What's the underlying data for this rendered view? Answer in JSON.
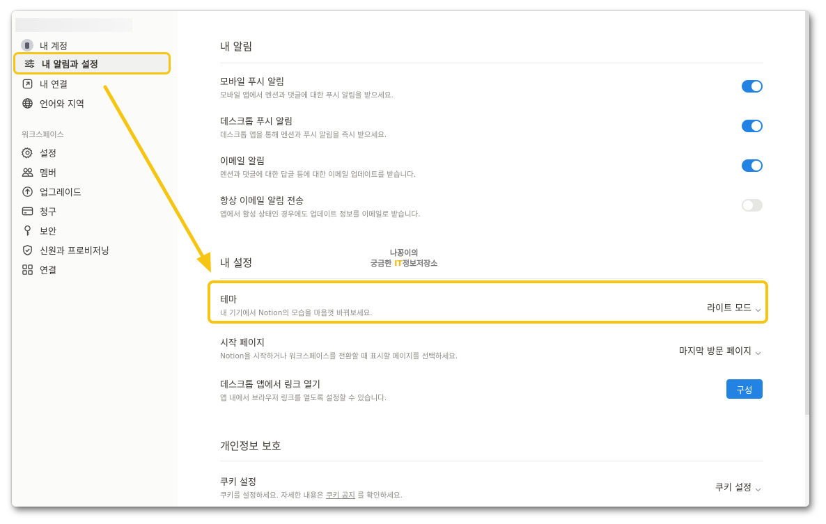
{
  "sidebar": {
    "account_items": [
      {
        "label": "내 계정",
        "icon": "avatar-icon"
      },
      {
        "label": "내 알림과 설정",
        "icon": "sliders-icon",
        "selected": true
      },
      {
        "label": "내 연결",
        "icon": "external-link-icon"
      },
      {
        "label": "언어와 지역",
        "icon": "globe-icon"
      }
    ],
    "workspace_title": "워크스페이스",
    "workspace_items": [
      {
        "label": "설정",
        "icon": "gear-icon"
      },
      {
        "label": "멤버",
        "icon": "members-icon"
      },
      {
        "label": "업그레이드",
        "icon": "upgrade-icon"
      },
      {
        "label": "청구",
        "icon": "card-icon"
      },
      {
        "label": "보안",
        "icon": "key-icon"
      },
      {
        "label": "신원과 프로비저닝",
        "icon": "shield-icon"
      },
      {
        "label": "연결",
        "icon": "grid-icon"
      }
    ]
  },
  "notifications": {
    "title": "내 알림",
    "items": [
      {
        "title": "모바일 푸시 알림",
        "desc": "모바일 앱에서 멘션과 댓글에 대한 푸시 알림을 받으세요.",
        "on": true
      },
      {
        "title": "데스크톱 푸시 알림",
        "desc": "데스크톱 앱을 통해 멘션과 푸시 알림을 즉시 받으세요.",
        "on": true
      },
      {
        "title": "이메일 알림",
        "desc": "멘션과 댓글에 대한 답글 등에 대한 이메일 업데이트를 받습니다.",
        "on": true
      },
      {
        "title": "항상 이메일 알림 전송",
        "desc": "앱에서 활성 상태인 경우에도 업데이트 정보를 이메일로 받습니다.",
        "on": false
      }
    ]
  },
  "settings": {
    "title": "내 설정",
    "theme": {
      "title": "테마",
      "desc": "내 기기에서 Notion의 모습을 마음껏 바꿔보세요.",
      "value": "라이트 모드"
    },
    "start_page": {
      "title": "시작 페이지",
      "desc": "Notion을 시작하거나 워크스페이스를 전환할 때 표시할 페이지를 선택하세요.",
      "value": "마지막 방문 페이지"
    },
    "desktop_links": {
      "title": "데스크톱 앱에서 링크 열기",
      "desc": "앱 내에서 브라우저 링크를 열도록 설정할 수 있습니다.",
      "button": "구성"
    }
  },
  "privacy": {
    "title": "개인정보 보호",
    "cookies": {
      "title": "쿠키 설정",
      "desc_pre": "쿠키를 설정하세요. 자세한 내용은 ",
      "desc_link": "쿠키 공지",
      "desc_post": " 를 확인하세요.",
      "value": "쿠키 설정"
    }
  },
  "watermark": {
    "line1": "나꽁이의",
    "line2_pre": "궁금한 ",
    "line2_it": "IT",
    "line2_post": "정보저장소"
  },
  "colors": {
    "accent": "#2383e2",
    "highlight": "#f6c514"
  }
}
